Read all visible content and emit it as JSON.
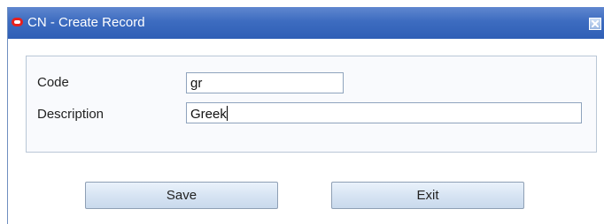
{
  "window": {
    "title": "CN - Create Record"
  },
  "form": {
    "code_label": "Code",
    "code_value": "gr",
    "description_label": "Description",
    "description_value": "Greek"
  },
  "buttons": {
    "save_label": "Save",
    "exit_label": "Exit"
  },
  "icons": {
    "app": "oracle-logo-icon",
    "close": "close-icon"
  },
  "colors": {
    "titlebar": "#3d6cc0",
    "app_icon": "#e8201c"
  }
}
